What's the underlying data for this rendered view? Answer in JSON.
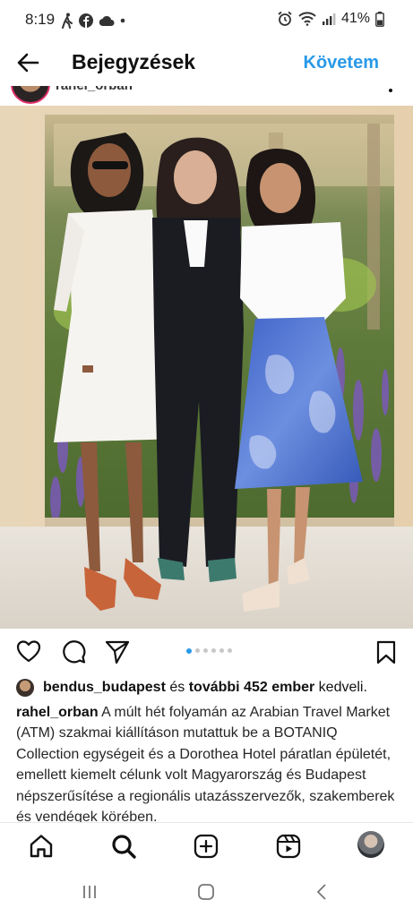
{
  "status_bar": {
    "time": "8:19",
    "battery": "41%"
  },
  "header": {
    "title": "Bejegyzések",
    "follow_label": "Követem"
  },
  "post": {
    "username": "rahel_orban",
    "carousel": {
      "total": 6,
      "active": 0
    }
  },
  "likes": {
    "user": "bendus_budapest",
    "middle": "és",
    "count_text": "további 452 ember",
    "suffix": "kedveli."
  },
  "caption": {
    "username": "rahel_orban",
    "text": "A múlt hét folyamán az Arabian Travel Market (ATM) szakmai kiállításon mutattuk be a BOTANIQ Collection egységeit és a Dorothea Hotel páratlan épületét, emellett kiemelt célunk volt Magyarország és Budapest népszerűsítése a regionális utazásszervezők, szakemberek és vendégek körében."
  },
  "icons": {
    "back": "arrow-left-icon",
    "like": "heart-icon",
    "comment": "comment-icon",
    "share": "paper-plane-icon",
    "save": "bookmark-icon",
    "home": "home-icon",
    "search": "search-icon",
    "create": "plus-square-icon",
    "reels": "reels-icon",
    "more": "more-icon"
  },
  "colors": {
    "accent": "#2a9ae8",
    "text": "#111111"
  }
}
